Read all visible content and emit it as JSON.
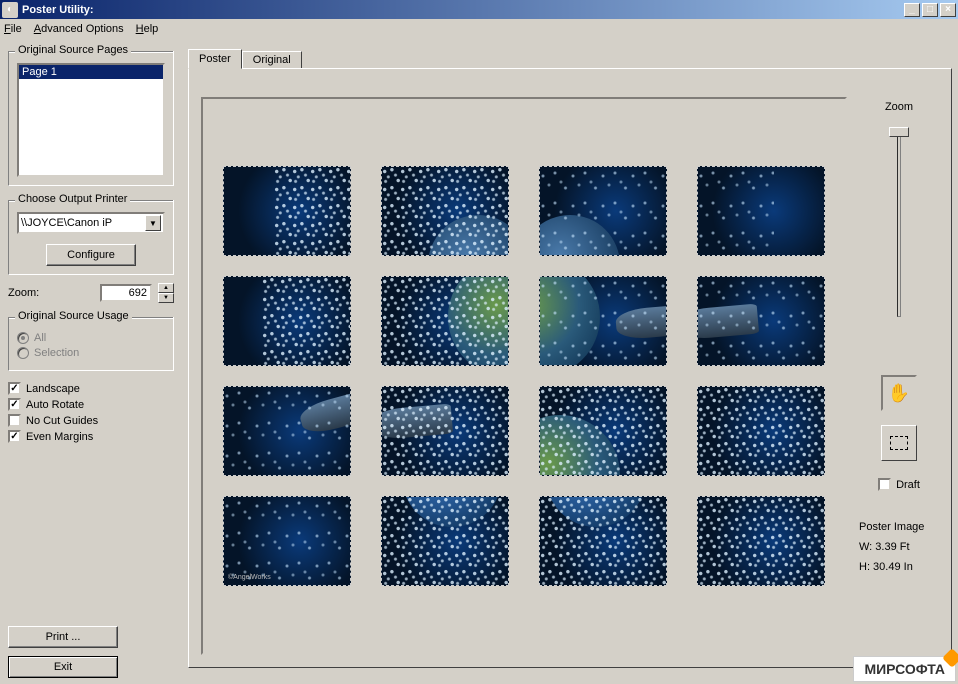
{
  "window": {
    "title": "Poster Utility:"
  },
  "menu": {
    "file": "File",
    "advanced": "Advanced Options",
    "help": "Help"
  },
  "sidebar": {
    "source_pages": {
      "legend": "Original Source Pages",
      "items": [
        "Page 1"
      ]
    },
    "printer": {
      "legend": "Choose Output Printer",
      "selected": "\\\\JOYCE\\Canon iP",
      "configure": "Configure"
    },
    "zoom": {
      "label": "Zoom:",
      "value": "692"
    },
    "usage": {
      "legend": "Original Source Usage",
      "all": "All",
      "selection": "Selection"
    },
    "checks": {
      "landscape": "Landscape",
      "auto_rotate": "Auto Rotate",
      "no_cut": "No Cut Guides",
      "even_margins": "Even Margins"
    },
    "print": "Print ...",
    "exit": "Exit"
  },
  "tabs": {
    "poster": "Poster",
    "original": "Original"
  },
  "right": {
    "zoom": "Zoom",
    "draft": "Draft",
    "info_title": "Poster Image",
    "width": "W: 3.39 Ft",
    "height": "H: 30.49 In"
  },
  "preview": {
    "watermark": "©AngelWorks"
  },
  "page_watermark": "МИРСОФТА"
}
